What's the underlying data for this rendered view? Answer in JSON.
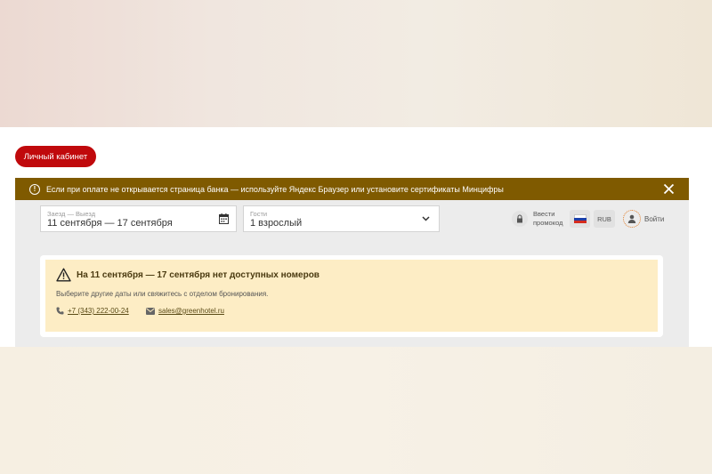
{
  "header": {
    "account_button": "Личный кабинет"
  },
  "notice": {
    "text": "Если при оплате не открывается страница банка — используйте Яндекс Браузер или установите сертификаты Минцифры",
    "icon": "exclamation-circle-icon",
    "close_icon": "close-icon"
  },
  "search": {
    "dates": {
      "label": "Заезд — Выезд",
      "value": "11 сентября — 17 сентября",
      "icon": "calendar-icon"
    },
    "guests": {
      "label": "Гости",
      "value": "1 взрослый",
      "icon": "chevron-down-icon"
    }
  },
  "toolbar": {
    "promo_label": "Ввести промокод",
    "language_flag": "ru-flag-icon",
    "currency": "RUB",
    "login_label": "Войти"
  },
  "alert": {
    "title": "На 11 сентября — 17 сентября нет доступных номеров",
    "text": "Выберите другие даты или свяжитесь с отделом бронирования.",
    "phone": "+7 (343) 222-00-24",
    "email": "sales@greenhotel.ru",
    "icon": "warning-triangle-icon"
  },
  "colors": {
    "accent_red": "#c0090c",
    "notice_bg": "#7f5a00",
    "alert_bg": "#fdedc5",
    "login_ring": "#e07f2c"
  }
}
